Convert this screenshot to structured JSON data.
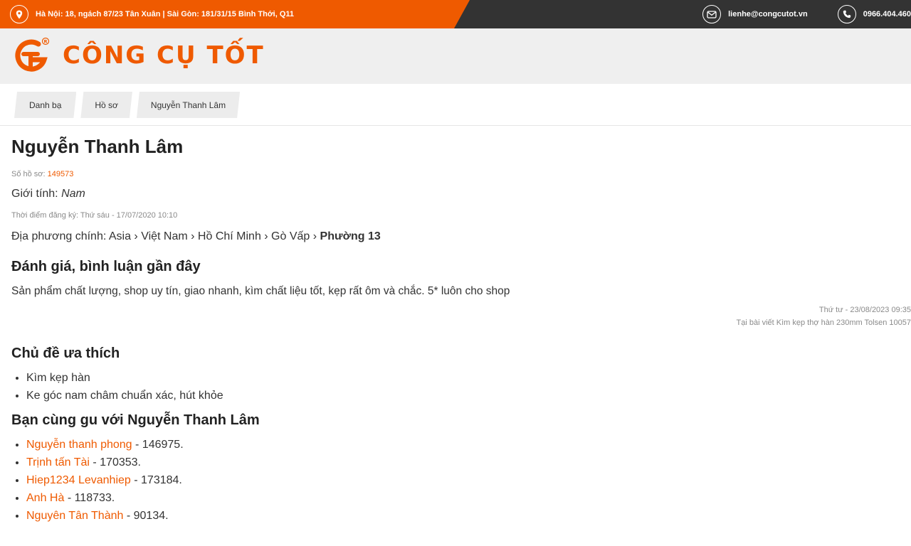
{
  "topbar": {
    "address": "Hà Nội: 18, ngách 87/23 Tân Xuân | Sài Gòn: 181/31/15 Bình Thới, Q11",
    "email": "lienhe@congcutot.vn",
    "phone": "0966.404.460"
  },
  "brand": {
    "name": "CÔNG CỤ TỐT",
    "accent": "#ef5a00"
  },
  "breadcrumb": [
    "Danh bạ",
    "Hồ sơ",
    "Nguyễn Thanh Lâm"
  ],
  "profile": {
    "name": "Nguyễn Thanh Lâm",
    "id_label": "Số hồ sơ:",
    "id_value": "149573",
    "gender_label": "Giới tính:",
    "gender_value": "Nam",
    "registered": "Thời điểm đăng ký: Thứ sáu - 17/07/2020 10:10",
    "location_label": "Địa phương chính:",
    "location_path": "Asia › Việt Nam › Hồ Chí Minh › Gò Vấp ›",
    "location_last": "Phường 13"
  },
  "reviews": {
    "heading": "Đánh giá, bình luận gần đây",
    "items": [
      {
        "text": "Sản phẩm chất lượng, shop uy tín, giao nhanh, kìm chất liệu tốt, kẹp rất ôm và chắc. 5* luôn cho shop",
        "date": "Thứ tư - 23/08/2023 09:35",
        "source": "Tại bài viết Kìm kẹp thợ hàn 230mm Tolsen 10057"
      }
    ]
  },
  "topics": {
    "heading": "Chủ đề ưa thích",
    "items": [
      "Kìm kẹp hàn",
      "Ke góc nam châm chuẩn xác, hút khỏe"
    ]
  },
  "friends": {
    "heading": "Bạn cùng gu với Nguyễn Thanh Lâm",
    "items": [
      {
        "name": "Nguyễn thanh phong",
        "id": " - 146975."
      },
      {
        "name": "Trịnh tấn Tài",
        "id": " - 170353."
      },
      {
        "name": "Hiep1234 Levanhiep",
        "id": " - 173184."
      },
      {
        "name": "Anh Hà",
        "id": " - 118733."
      },
      {
        "name": "Nguyên Tân Thành",
        "id": " - 90134."
      }
    ]
  },
  "icons": {
    "address": "map-pin-icon",
    "email": "envelope-icon",
    "phone": "phone-icon",
    "logo": "cct-logo-icon"
  }
}
